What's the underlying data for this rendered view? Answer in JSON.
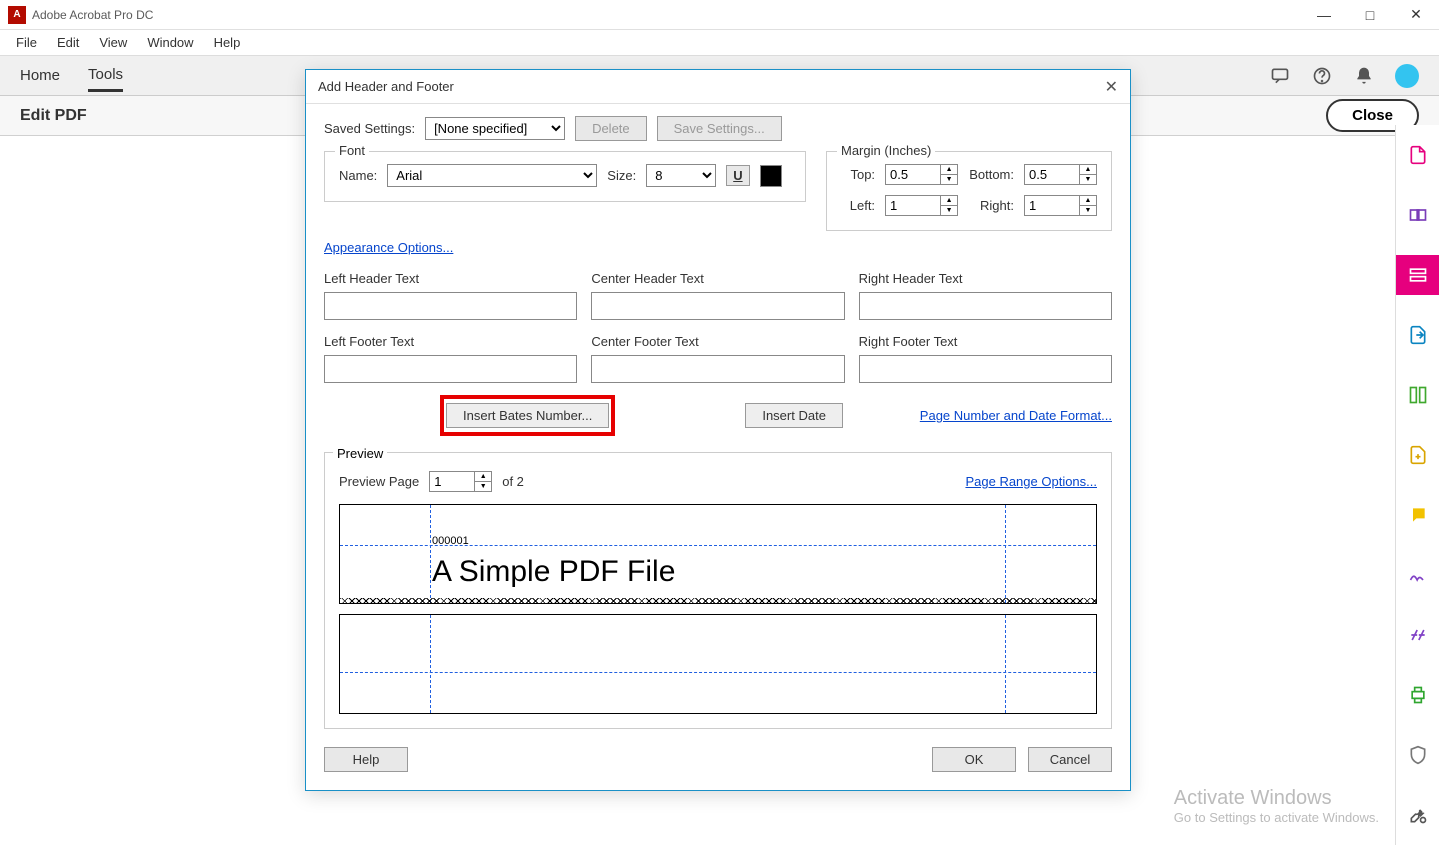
{
  "app": {
    "title": "Adobe Acrobat Pro DC",
    "icon_letter": "A"
  },
  "menu": {
    "file": "File",
    "edit": "Edit",
    "view": "View",
    "window": "Window",
    "help": "Help"
  },
  "tabs": {
    "home": "Home",
    "tools": "Tools"
  },
  "sub": {
    "edit_pdf": "Edit PDF",
    "close": "Close"
  },
  "dialog": {
    "title": "Add Header and Footer",
    "saved_settings_label": "Saved Settings:",
    "saved_settings_value": "[None specified]",
    "delete": "Delete",
    "save_settings": "Save Settings...",
    "font_legend": "Font",
    "name_label": "Name:",
    "font_name": "Arial",
    "size_label": "Size:",
    "font_size": "8",
    "appearance_link": "Appearance Options...",
    "margin_legend": "Margin (Inches)",
    "top_label": "Top:",
    "top_val": "0.5",
    "bottom_label": "Bottom:",
    "bottom_val": "0.5",
    "left_label": "Left:",
    "left_val": "1",
    "right_label": "Right:",
    "right_val": "1",
    "cells": {
      "lh": "Left Header Text",
      "ch": "Center Header Text",
      "rh": "Right Header Text",
      "lf": "Left Footer Text",
      "cf": "Center Footer Text",
      "rf": "Right Footer Text"
    },
    "insert_bates": "Insert Bates Number...",
    "insert_date": "Insert Date",
    "page_num_date_link": "Page Number and Date Format...",
    "preview_legend": "Preview",
    "preview_page_label": "Preview Page",
    "preview_page_val": "1",
    "preview_of": "of 2",
    "page_range_link": "Page Range Options...",
    "bates_sample": "000001",
    "sample_title": "A Simple PDF File",
    "help": "Help",
    "ok": "OK",
    "cancel": "Cancel"
  },
  "watermark": {
    "h": "Activate Windows",
    "s": "Go to Settings to activate Windows."
  }
}
